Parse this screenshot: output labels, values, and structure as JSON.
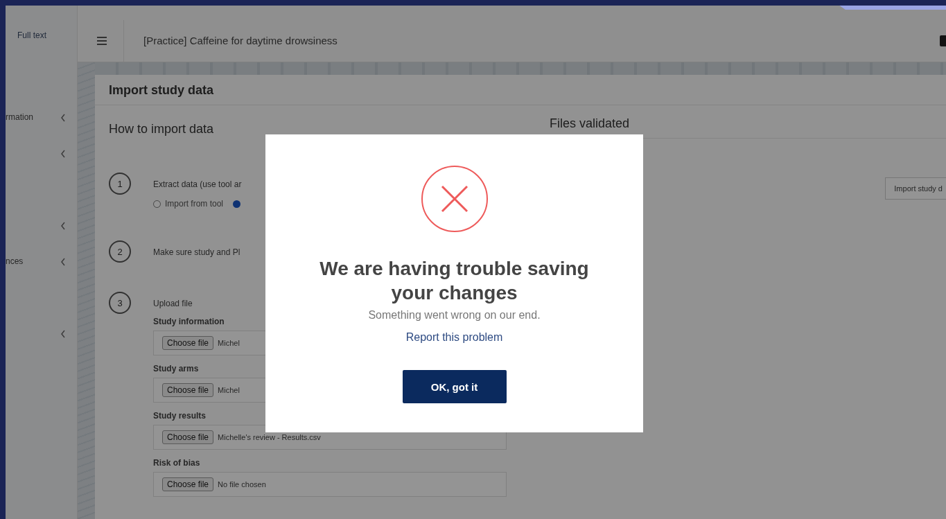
{
  "sidebar": {
    "title": "Full text",
    "groups": [
      [
        {
          "kind": "label",
          "label": "rmation"
        },
        {
          "kind": "icon"
        }
      ],
      [
        {
          "kind": "icon"
        },
        {
          "kind": "label",
          "label": "nces"
        }
      ],
      [
        {
          "kind": "icon"
        }
      ]
    ]
  },
  "header": {
    "title": "[Practice] Caffeine for daytime drowsiness"
  },
  "card": {
    "title": "Import study data",
    "left_heading": "How to import data",
    "right_heading": "Files validated",
    "import_button": "Import study d",
    "steps": [
      {
        "number": "1",
        "text": "Extract data (use tool ar",
        "options": [
          {
            "label": "Import from tool",
            "selected": false
          },
          {
            "selected": true
          }
        ]
      },
      {
        "number": "2",
        "text": "Make sure study and Pl"
      },
      {
        "number": "3",
        "text": "Upload file",
        "files": [
          {
            "label": "Study information",
            "button": "Choose file",
            "file": "Michel"
          },
          {
            "label": "Study arms",
            "button": "Choose file",
            "file": "Michel"
          },
          {
            "label": "Study results",
            "button": "Choose file",
            "file": "Michelle's review - Results.csv"
          },
          {
            "label": "Risk of bias",
            "button": "Choose file",
            "file": "No file chosen"
          }
        ]
      }
    ]
  },
  "dialog": {
    "title": "We are having trouble saving your changes",
    "message": "Something went wrong on our end.",
    "link": "Report this problem",
    "button": "OK, got it"
  }
}
